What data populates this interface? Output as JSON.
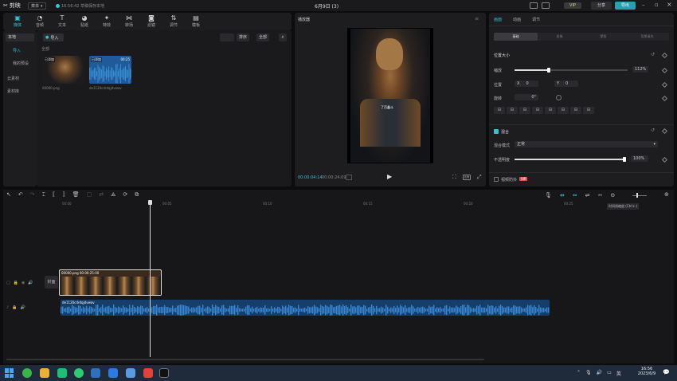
{
  "app": {
    "name": "剪映",
    "menu_label": "菜单",
    "autosave_text": "16:56:42 草稿保存本地",
    "project_title": "6月9日 (3)",
    "vip_label": "VIP",
    "share_label": "分享",
    "export_label": "导出"
  },
  "toolbar": {
    "items": [
      {
        "label": "媒体",
        "icon": "media-icon"
      },
      {
        "label": "音频",
        "icon": "audio-icon"
      },
      {
        "label": "文本",
        "icon": "text-icon"
      },
      {
        "label": "贴纸",
        "icon": "sticker-icon"
      },
      {
        "label": "特效",
        "icon": "effects-icon"
      },
      {
        "label": "转场",
        "icon": "transition-icon"
      },
      {
        "label": "滤镜",
        "icon": "filter-icon"
      },
      {
        "label": "调节",
        "icon": "adjust-icon"
      },
      {
        "label": "模板",
        "icon": "template-icon"
      }
    ]
  },
  "sidenav": {
    "items": [
      "本地",
      "导入",
      "我的预设",
      "云素材",
      "素材库"
    ]
  },
  "media": {
    "import_label": "导入",
    "section_label": "全部",
    "sort_label": "排序",
    "filter_label": "全部",
    "clips": [
      {
        "badge": "已添加",
        "name": "00000.png",
        "duration": ""
      },
      {
        "badge": "已添加",
        "name": "de1120cdrdqjdvwav",
        "duration": "00:25"
      }
    ]
  },
  "player": {
    "title": "播放器",
    "current_time": "00:00:04:14",
    "total_time": "00:00:24:09",
    "overlay_text": "了百鑫斗",
    "ratio_label": "比例"
  },
  "inspector": {
    "tabs": [
      "画面",
      "动画",
      "调节"
    ],
    "subtabs": [
      "基础",
      "抠像",
      "蒙版",
      "背景填充"
    ],
    "position_size_label": "位置大小",
    "scale_label": "缩放",
    "scale_value": "112%",
    "scale_fraction": 0.3,
    "position_label": "位置",
    "pos_x": "0",
    "pos_y": "0",
    "x_label": "X",
    "y_label": "Y",
    "rotate_label": "旋转",
    "rotate_value": "0°",
    "blend_label": "混合",
    "blend_mode_label": "混合模式",
    "blend_mode_value": "正常",
    "opacity_label": "不透明度",
    "opacity_value": "100%",
    "opacity_fraction": 1.0,
    "stabilize_label": "视频防抖",
    "vip_badge": "VIP"
  },
  "timeline": {
    "ruler": [
      "00:00",
      "00:05",
      "00:10",
      "00:15",
      "00:20",
      "00:25"
    ],
    "video_clip_label": "00000.png  00:00:25:00",
    "audio_clip_label": "de1120cdrdqjdvwav",
    "cover_label": "封面",
    "tooltip": "时间线缩放 (Ctrl+-)"
  },
  "taskbar": {
    "time": "16:56",
    "date": "2023/6/9"
  }
}
